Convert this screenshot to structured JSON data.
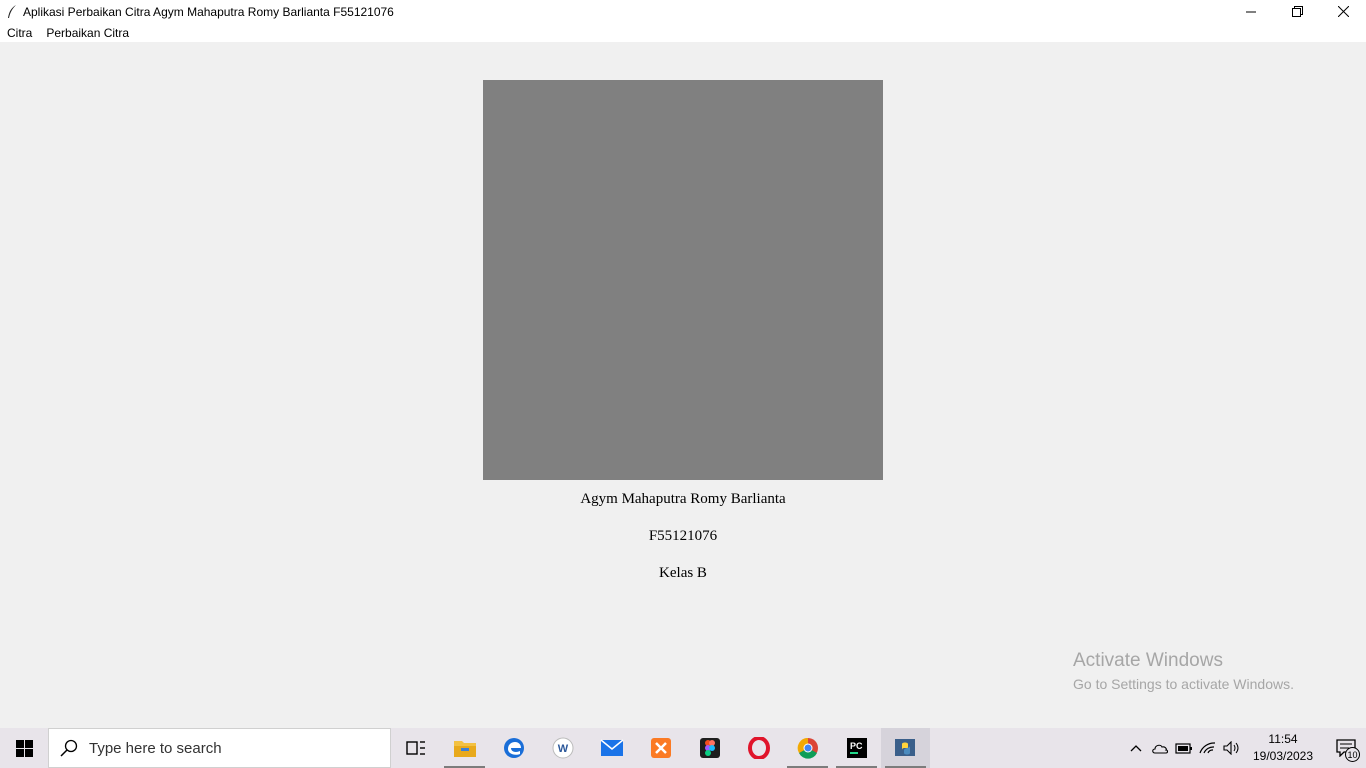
{
  "window": {
    "title": "Aplikasi Perbaikan Citra Agym Mahaputra Romy Barlianta F55121076",
    "icon": "feather-icon",
    "controls": [
      "minimize-icon",
      "restore-icon",
      "close-icon"
    ]
  },
  "menu": {
    "items": [
      {
        "label": "Citra"
      },
      {
        "label": "Perbaikan Citra"
      }
    ]
  },
  "main": {
    "image_color": "#808080",
    "name": "Agym Mahaputra Romy Barlianta",
    "nim": "F55121076",
    "kelas": "Kelas B"
  },
  "watermark": {
    "title": "Activate Windows",
    "subtitle": "Go to Settings to activate Windows."
  },
  "taskbar": {
    "search_placeholder": "Type here to search",
    "apps": [
      "task-view-icon",
      "file-explorer-icon",
      "edge-icon",
      "word-icon",
      "mail-icon",
      "xampp-icon",
      "figma-icon",
      "opera-icon",
      "chrome-icon",
      "pycharm-icon",
      "python-icon"
    ],
    "time": "11:54",
    "date": "19/03/2023",
    "notification_count": "10"
  }
}
